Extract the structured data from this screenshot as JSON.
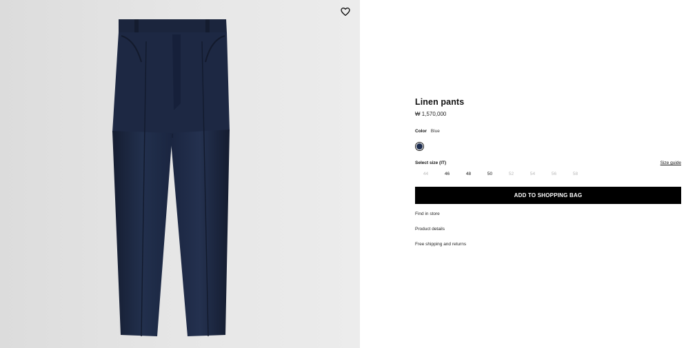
{
  "product": {
    "title": "Linen pants",
    "price": "₩ 1,570,000",
    "image_alt": "navy-linen-pants-photo"
  },
  "wishlist": {
    "icon": "heart-icon"
  },
  "color": {
    "label": "Color",
    "value": "Blue",
    "swatch_hex": "#1c2c4e"
  },
  "size": {
    "label": "Select size (IT)",
    "guide_label": "Size guide",
    "options": [
      {
        "label": "44",
        "available": false
      },
      {
        "label": "46",
        "available": true
      },
      {
        "label": "48",
        "available": true
      },
      {
        "label": "50",
        "available": true
      },
      {
        "label": "52",
        "available": false
      },
      {
        "label": "54",
        "available": false
      },
      {
        "label": "56",
        "available": false
      },
      {
        "label": "58",
        "available": false
      }
    ]
  },
  "actions": {
    "add_to_bag": "ADD TO SHOPPING BAG"
  },
  "links": [
    "Find in store",
    "Product details",
    "Free shipping and returns"
  ],
  "colors": {
    "image_background": "#e4e4e4",
    "pants": "#1c2740",
    "button_bg": "#000000",
    "unavailable_size": "#b8b8b8"
  }
}
